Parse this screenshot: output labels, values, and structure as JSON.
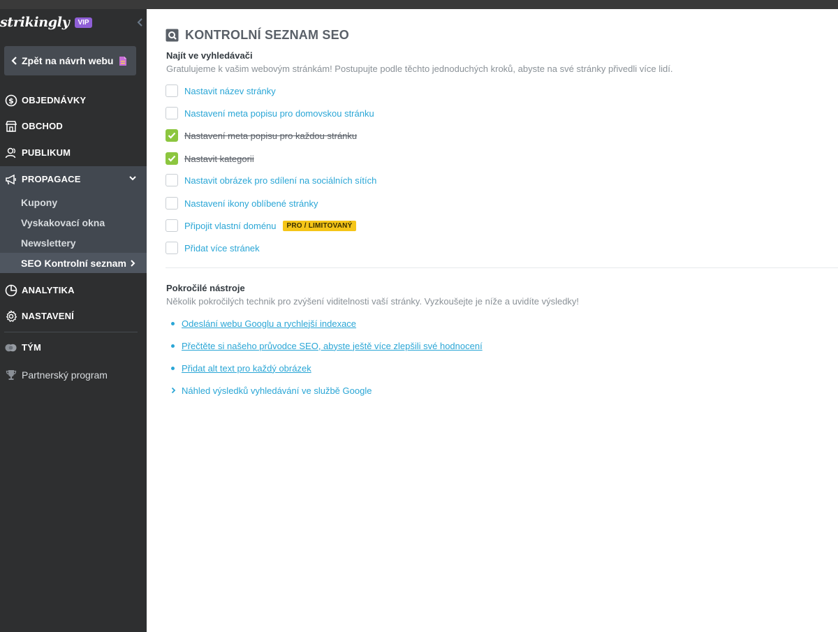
{
  "sidebar": {
    "brand": "strikingly",
    "vip": "VIP",
    "back_label": "Zpět na návrh webu",
    "items": [
      {
        "label": "OBJEDNÁVKY",
        "icon": "dollar-circle-icon"
      },
      {
        "label": "OBCHOD",
        "icon": "store-icon"
      },
      {
        "label": "PUBLIKUM",
        "icon": "users-icon"
      },
      {
        "label": "PROPAGACE",
        "icon": "megaphone-icon"
      },
      {
        "label": "ANALYTIKA",
        "icon": "pie-chart-icon"
      },
      {
        "label": "NASTAVENÍ",
        "icon": "gear-icon"
      },
      {
        "label": "TÝM",
        "icon": "team-icon"
      },
      {
        "label": "Partnerský program",
        "icon": "trophy-icon"
      }
    ],
    "sub_items": [
      {
        "label": "Kupony"
      },
      {
        "label": "Vyskakovací okna"
      },
      {
        "label": "Newslettery"
      },
      {
        "label": "SEO Kontrolní seznam"
      }
    ]
  },
  "main": {
    "title": "KONTROLNÍ SEZNAM SEO",
    "find": {
      "heading": "Najít ve vyhledávači",
      "desc": "Gratulujeme k vašim webovým stránkám! Postupujte podle těchto jednoduchých kroků, abyste na své stránky přivedli více lidí."
    },
    "checklist": [
      {
        "label": "Nastavit název stránky",
        "done": false
      },
      {
        "label": "Nastavení meta popisu pro domovskou stránku",
        "done": false
      },
      {
        "label": "Nastavení meta popisu pro každou stránku",
        "done": true
      },
      {
        "label": "Nastavit kategorii",
        "done": true
      },
      {
        "label": "Nastavit obrázek pro sdílení na sociálních sítích",
        "done": false
      },
      {
        "label": "Nastavení ikony oblíbené stránky",
        "done": false
      },
      {
        "label": "Připojit vlastní doménu",
        "done": false,
        "badge": "PRO / LIMITOVANÝ"
      },
      {
        "label": "Přidat více stránek",
        "done": false
      }
    ],
    "advanced": {
      "heading": "Pokročilé nástroje",
      "desc": "Několik pokročilých technik pro zvýšení viditelnosti vaší stránky. Vyzkoušejte je níže a uvidíte výsledky!",
      "links": [
        {
          "label": "Odeslání webu Googlu a rychlejší indexace"
        },
        {
          "label": "Přečtěte si našeho průvodce SEO, abyste ještě více zlepšili své hodnocení"
        },
        {
          "label": "Přidat alt text pro každý obrázek"
        }
      ],
      "expander": "Náhled výsledků vyhledávání ve službě Google"
    }
  },
  "colors": {
    "sidebar_bg": "#2e2f30",
    "accent_link": "#2aa6d6",
    "check_green": "#8cc63f",
    "vip_purple": "#8f5fd6",
    "pro_yellow": "#f5c518"
  }
}
